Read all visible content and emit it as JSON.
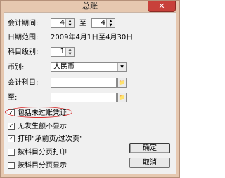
{
  "window": {
    "title": "总账",
    "close_glyph": "✕"
  },
  "form": {
    "period_label": "会计期间:",
    "period_from": "4",
    "period_to_label": "至",
    "period_to": "4",
    "date_range_label": "日期范围:",
    "date_range_value": "2009年4月1日至4月30日",
    "subject_level_label": "科目级别:",
    "subject_level": "1",
    "currency_label": "币别:",
    "currency_value": "人民币",
    "account_label": "会计科目:",
    "account_value": "",
    "to_label": "至:",
    "to_value": ""
  },
  "options": [
    {
      "label": "包括未过账凭证",
      "checked": true
    },
    {
      "label": "无发生额不显示",
      "checked": true
    },
    {
      "label": "打印\"承前页/过次页\"",
      "checked": true
    },
    {
      "label": "按科目分页打印",
      "checked": false
    },
    {
      "label": "按科目分页显示",
      "checked": false
    }
  ],
  "buttons": {
    "ok": "确定",
    "cancel": "取消"
  },
  "colors": {
    "title_bar": "#e6c8b0",
    "close": "#c8413a",
    "annotation": "#d62b2b"
  }
}
